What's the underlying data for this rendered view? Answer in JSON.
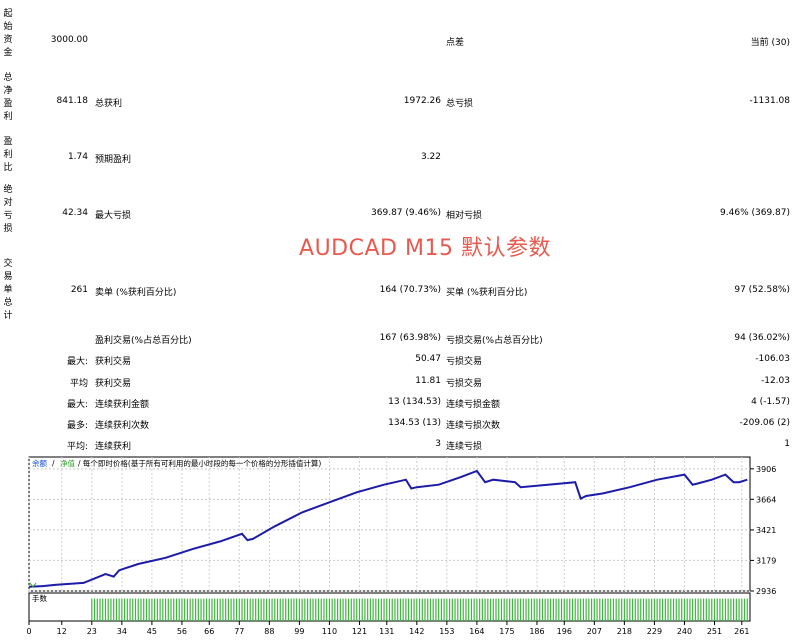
{
  "report": {
    "initial_deposit": {
      "label": "起始资金",
      "value": "3000.00",
      "mid_label": "点差",
      "right_value": "当前 (30)"
    },
    "total_net_profit": {
      "label": "总净盈利",
      "value": "841.18",
      "c1_label": "总获利",
      "c1_value": "1972.26",
      "c2_label": "总亏损",
      "c2_value": "-1131.08"
    },
    "profit_factor": {
      "label": "盈利比",
      "value": "1.74",
      "c1_label": "预期盈利",
      "c1_value": "3.22"
    },
    "absolute_drawdown": {
      "label": "绝对亏损",
      "value": "42.34",
      "c1_label": "最大亏损",
      "c1_value": "369.87 (9.46%)",
      "c2_label": "相对亏损",
      "c2_value": "9.46% (369.87)"
    },
    "total_trades": {
      "label": "交易单总计",
      "value": "261",
      "c1_label": "卖单 (%获利百分比)",
      "c1_value": "164 (70.73%)",
      "c2_label": "买单 (%获利百分比)",
      "c2_value": "97 (52.58%)"
    },
    "rows": [
      {
        "prefix": "",
        "c1_label": "盈利交易(%占总百分比)",
        "c1_value": "167 (63.98%)",
        "c2_label": "亏损交易(%占总百分比)",
        "c2_value": "94 (36.02%)"
      },
      {
        "prefix": "最大:",
        "c1_label": "获利交易",
        "c1_value": "50.47",
        "c2_label": "亏损交易",
        "c2_value": "-106.03"
      },
      {
        "prefix": "平均",
        "c1_label": "获利交易",
        "c1_value": "11.81",
        "c2_label": "亏损交易",
        "c2_value": "-12.03"
      },
      {
        "prefix": "最大:",
        "c1_label": "连续获利金额",
        "c1_value": "13 (134.53)",
        "c2_label": "连续亏损金额",
        "c2_value": "4 (-1.57)"
      },
      {
        "prefix": "最多:",
        "c1_label": "连续获利次数",
        "c1_value": "134.53 (13)",
        "c2_label": "连续亏损次数",
        "c2_value": "-209.06 (2)"
      },
      {
        "prefix": "平均:",
        "c1_label": "连续获利",
        "c1_value": "3",
        "c2_label": "连续亏损",
        "c2_value": "1"
      }
    ]
  },
  "overlay_title": "AUDCAD M15 默认参数",
  "chart_data": {
    "type": "line",
    "legend": {
      "balance": "余额",
      "equity": "净值",
      "note": "/ 每个即时价格(基于所有可利用的最小时段的每一个价格的分形插值计算)"
    },
    "volume_label": "手数",
    "colors": {
      "balance": "#1c1ca8",
      "equity": "#2ea12e",
      "volume": "#3cb83c",
      "legend_balance": "#1a4fd8",
      "legend_equity": "#2ea12e"
    },
    "ylim": [
      2936,
      4000
    ],
    "y_ticks": [
      "3906",
      "3664",
      "3421",
      "3179",
      "2936"
    ],
    "y_tick_values": [
      3906,
      3664,
      3421,
      3179,
      2936
    ],
    "xlim": [
      0,
      264
    ],
    "x_ticks": [
      "0",
      "12",
      "23",
      "34",
      "45",
      "56",
      "66",
      "77",
      "88",
      "99",
      "110",
      "121",
      "131",
      "142",
      "153",
      "164",
      "175",
      "186",
      "196",
      "207",
      "218",
      "229",
      "240",
      "251",
      "261"
    ],
    "x_tick_values": [
      0,
      12,
      23,
      34,
      45,
      56,
      66,
      77,
      88,
      99,
      110,
      121,
      131,
      142,
      153,
      164,
      175,
      186,
      196,
      207,
      218,
      229,
      240,
      251,
      261
    ],
    "balance": {
      "x": [
        0,
        5,
        10,
        20,
        28,
        31,
        33,
        40,
        50,
        60,
        70,
        78,
        80,
        82,
        90,
        100,
        110,
        120,
        130,
        138,
        140,
        142,
        150,
        158,
        164,
        167,
        170,
        178,
        180,
        190,
        200,
        202,
        204,
        210,
        220,
        230,
        240,
        243,
        245,
        250,
        255,
        258,
        260,
        263
      ],
      "y": [
        2970,
        2975,
        2985,
        3000,
        3070,
        3050,
        3100,
        3150,
        3200,
        3270,
        3330,
        3390,
        3340,
        3350,
        3450,
        3560,
        3640,
        3720,
        3780,
        3820,
        3750,
        3760,
        3780,
        3840,
        3890,
        3800,
        3820,
        3800,
        3760,
        3780,
        3800,
        3670,
        3690,
        3710,
        3760,
        3820,
        3860,
        3780,
        3790,
        3820,
        3860,
        3800,
        3800,
        3820
      ]
    },
    "volume": {
      "first_x": 23,
      "last_x": 263,
      "count": 241,
      "level": 0.8
    }
  }
}
